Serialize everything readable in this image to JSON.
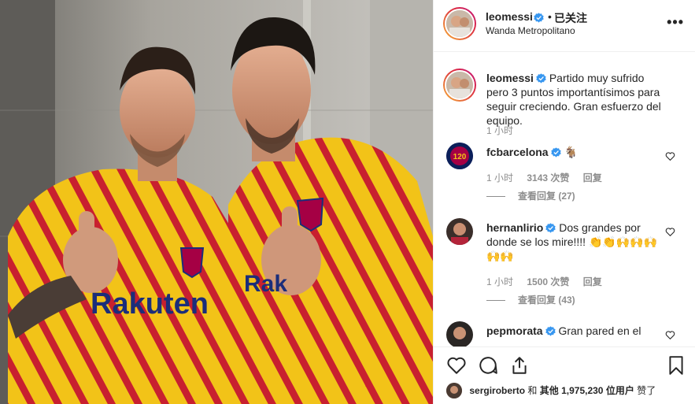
{
  "post": {
    "author": "leomessi",
    "location": "Wanda Metropolitano",
    "follow_separator": "•",
    "follow_status": "已关注",
    "more_label": "•••"
  },
  "photo": {
    "jersey_sponsor": "Rakuten",
    "jersey_sponsor_partial": "Rak"
  },
  "caption": {
    "user": "leomessi",
    "text": "Partido muy sufrido pero 3 puntos importantísimos para seguir creciendo. Gran esfuerzo del equipo.",
    "time": "1 小时"
  },
  "comments": [
    {
      "user": "fcbarcelona",
      "text": "🐐",
      "avatar_text": "120",
      "time": "1 小时",
      "likes": "3143 次赞",
      "reply_label": "回复",
      "view_replies": "查看回复 (27)"
    },
    {
      "user": "hernanlirio",
      "text": "Dos grandes por donde se los mire!!!! 👏👏🙌🙌🙌🙌🙌",
      "time": "1 小时",
      "likes": "1500 次赞",
      "reply_label": "回复",
      "view_replies": "查看回复 (43)"
    },
    {
      "user": "pepmorata",
      "text": "Gran pared en el"
    }
  ],
  "liked_by": {
    "user": "sergiroberto",
    "joiner": "和",
    "others_label": "其他",
    "count": "1,975,230",
    "suffix": "位用户",
    "verb": "赞了"
  },
  "colors": {
    "jersey_yellow": "#f2c318",
    "jersey_red": "#c8202f",
    "verified_blue": "#3897f0",
    "muted_text": "#8e8e8e"
  }
}
